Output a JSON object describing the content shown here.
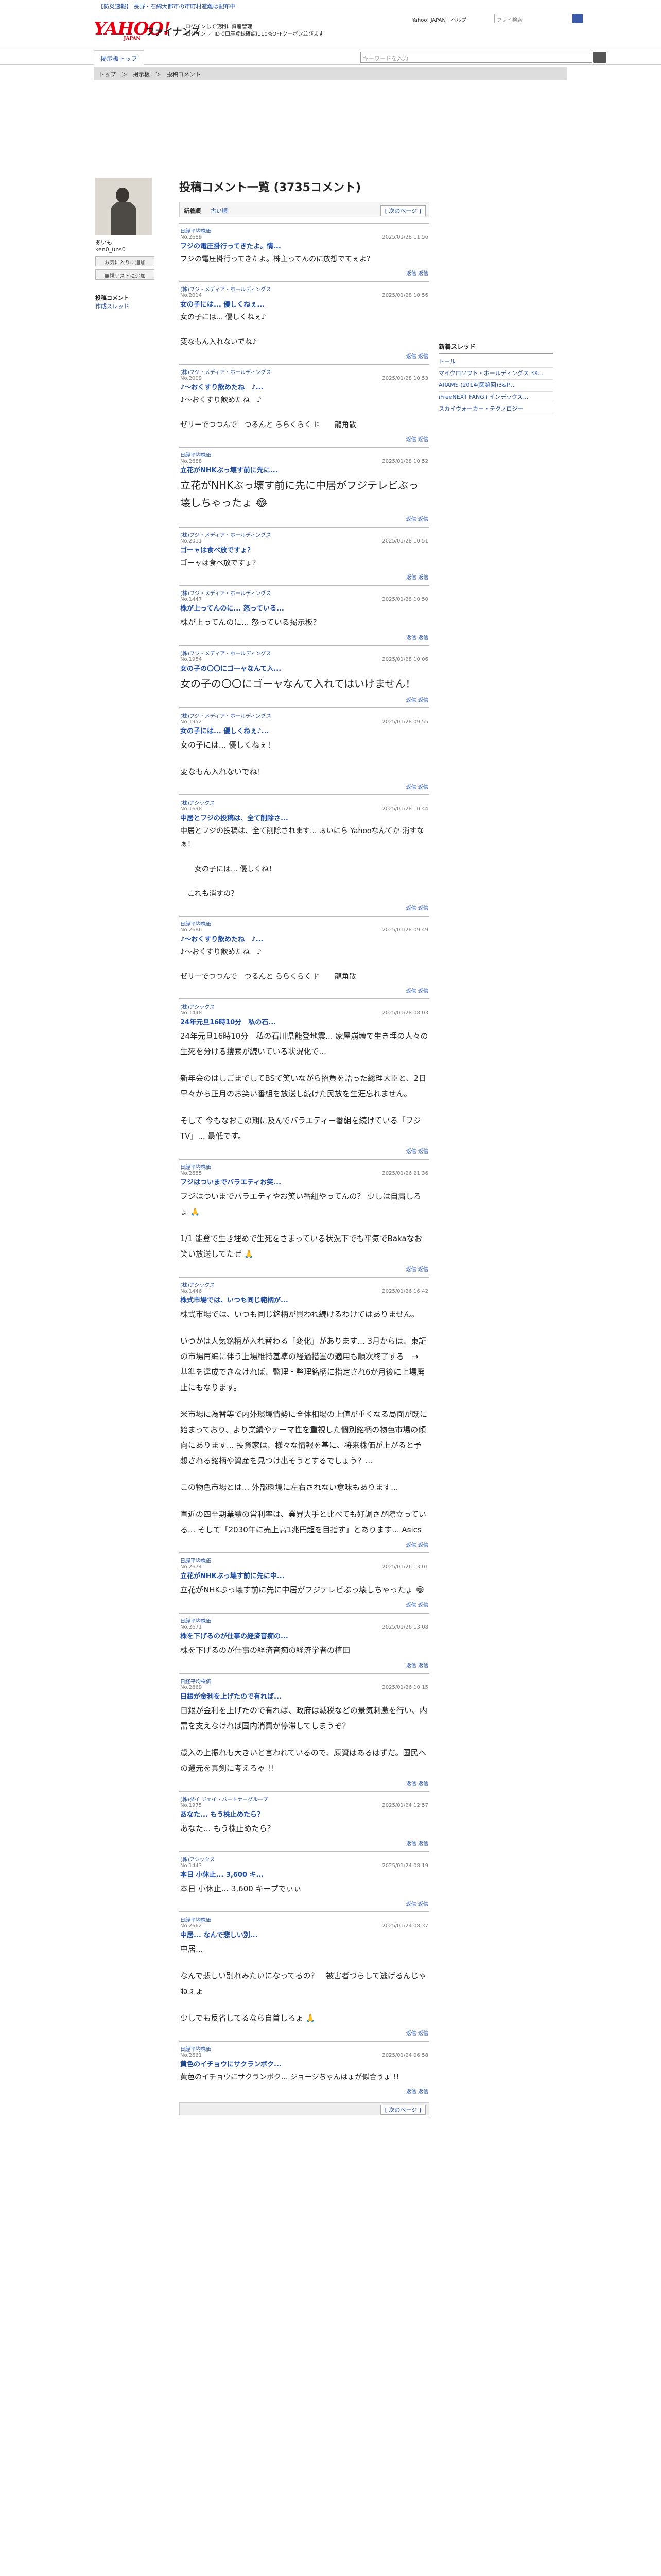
{
  "notice": {
    "prefix": "【防災速報】",
    "text": "長野・石綿大都市の市町村避難は配布中"
  },
  "header": {
    "logo": "YAHOO! JAPAN",
    "site": "ファイナンス",
    "promo_line1": "ログインして便利に資産管理",
    "promo_line2": "ログイン ／ IDで口座登録確認に10%OFFクーポン並びます",
    "links": "Yahoo! JAPAN　ヘルプ",
    "search_placeholder": "ファイ検索"
  },
  "nav": {
    "tab": "掲示板トップ",
    "quote_placeholder": "キーワードを入力"
  },
  "breadcrumb": "トップ　＞　掲示板　＞　投稿コメント",
  "profile": {
    "name": "あいも",
    "id": "ken0_uns0",
    "btn1": "お気に入りに追加",
    "btn2": "無視リストに追加",
    "nav1": "投稿コメント",
    "nav2": "作成スレッド"
  },
  "page": {
    "title": "投稿コメント一覧 (3735コメント)",
    "sort1": "新着順",
    "sort2": "古い順",
    "pager": "[ 次のページ ]"
  },
  "reply_label": "返信 返信",
  "sidebar": {
    "heading": "新着スレッド",
    "items": [
      "トール",
      "マイクロソフト・ホールディングス 3X...",
      "ARAMS (2014(図第回)3&P...",
      "iFreeNEXT FANG+インデックス...",
      "スカイウォーカー・テクノロジー"
    ]
  },
  "posts": [
    {
      "src": "日経平均株価",
      "no": "No.2689",
      "dt": "2025/01/28 11:56",
      "subj": "フジの電圧掛行ってきたよ。情...",
      "body": [
        "フジの電圧掛行ってきたよ。株主ってんのに放想でてぇよ？"
      ],
      "size": "s"
    },
    {
      "src": "(株)フジ・メディア・ホールディングス",
      "no": "No.2014",
      "dt": "2025/01/28 10:56",
      "subj": "女の子には... 優しくねぇ...",
      "body": [
        "女の子には... 優しくねぇ♪",
        "",
        "変なもん入れないでね♪"
      ],
      "size": "s"
    },
    {
      "src": "(株)フジ・メディア・ホールディングス",
      "no": "No.2009",
      "dt": "2025/01/28 10:53",
      "subj": "♪～おくすり飲めたね　♪...",
      "body": [
        "♪～おくすり飲めたね　♪",
        "",
        "ゼリーでつつんで　つるんと ららくらく ⚐　　龍角散"
      ],
      "size": "s"
    },
    {
      "src": "日経平均株価",
      "no": "No.2688",
      "dt": "2025/01/28 10:52",
      "subj": "立花がNHKぶっ壊す前に先に...",
      "body": [
        "立花がNHKぶっ壊す前に先に中居がフジテレビぶっ壊しちゃったょ 😂"
      ],
      "size": "l"
    },
    {
      "src": "(株)フジ・メディア・ホールディングス",
      "no": "No.2011",
      "dt": "2025/01/28 10:51",
      "subj": "ゴーャは食べ放ですょ？",
      "body": [
        "ゴーャは食べ放ですょ？"
      ],
      "size": "s"
    },
    {
      "src": "(株)フジ・メディア・ホールディングス",
      "no": "No.1447",
      "dt": "2025/01/28 10:50",
      "subj": "株が上ってんのに... 怒っている...",
      "body": [
        "株が上ってんのに... 怒っている掲示板？"
      ],
      "size": "m"
    },
    {
      "src": "(株)フジ・メディア・ホールディングス",
      "no": "No.1954",
      "dt": "2025/01/28 10:06",
      "subj": "女の子の〇〇にゴーャなんて入...",
      "body": [
        "女の子の〇〇にゴーャなんて入れてはいけません！"
      ],
      "size": "l"
    },
    {
      "src": "(株)フジ・メディア・ホールディングス",
      "no": "No.1952",
      "dt": "2025/01/28 09:55",
      "subj": "女の子には... 優しくねぇ♪...",
      "body": [
        "女の子には... 優しくねぇ！",
        "",
        "変なもん入れないでね！"
      ],
      "size": "m"
    },
    {
      "src": "(株)アシックス",
      "no": "No.1698",
      "dt": "2025/01/28 10:44",
      "subj": "中居とフジの投稿は、全て削除さ...",
      "body": [
        "中居とフジの投稿は、全て削除されます... ぁいにら Yahooなんてか 消すなぁ！",
        "",
        "　　女の子には... 優しくね！",
        "",
        "　これも消すの？"
      ],
      "size": "s"
    },
    {
      "src": "日経平均株価",
      "no": "No.2686",
      "dt": "2025/01/28 09:49",
      "subj": "♪～おくすり飲めたね　♪...",
      "body": [
        "♪～おくすり飲めたね　♪",
        "",
        "ゼリーでつつんで　つるんと ららくらく ⚐　　龍角散"
      ],
      "size": "s"
    },
    {
      "src": "(株)アシックス",
      "no": "No.1448",
      "dt": "2025/01/28 08:03",
      "subj": "24年元旦16時10分　私の石...",
      "body": [
        "24年元旦16時10分　私の石川県能登地震... 家屋崩壊で生き埋の人々の生死を分ける搜索が続いている状況化で...",
        "",
        "新年会のはしごまでしてBSで笑いながら招負を語った総理大臣と、2日早々から正月のお笑い番組を放送し続けた民放を生涯忘れません。",
        "",
        "そして 今もなおこの期に及んでバラエティー番組を続けている「フジTV」... 最低です。"
      ],
      "size": "m"
    },
    {
      "src": "日経平均株価",
      "no": "No.2685",
      "dt": "2025/01/26 21:36",
      "subj": "フジはついまでバラエティお笑...",
      "body": [
        "フジはついまでバラエティやお笑い番組やってんの？ 少しは自粛しろょ 🙏",
        "",
        "1/1 能登で生き埋めで生死をさまっている状況下でも平気でBakaなお笑い放送してたぜ 🙏"
      ],
      "size": "m"
    },
    {
      "src": "(株)アシックス",
      "no": "No.1446",
      "dt": "2025/01/26 16:42",
      "subj": "株式市場では、いつも同じ範柄が...",
      "body": [
        "株式市場では、いつも同じ銘柄が買われ続けるわけではありません。",
        "",
        "いつかは人気銘柄が入れ替わる「変化」があります... 3月からは、東証の市場再編に伴う上場維持基準の経過措置の適用も順次終了する　→　基準を達成できなければ、監理・整理銘柄に指定され6か月後に上場廃止にもなります。",
        "",
        "米市場に為替等で内外環境情勢に全体相場の上値が重くなる局面が既に始まっており、より業績やテーマ性を重視した個別銘柄の物色市場の傾向にあります... 投資家は、様々な情報を基に、将来株価が上がると予想される銘柄や資産を見つけ出そうとするでしょう？...",
        "",
        "この物色市場とは... 外部環境に左右されない意味もあります...",
        "",
        "直近の四半期業績の営利率は、業界大手と比べても好調さが際立っている... そして「2030年に売上高1兆円超を目指す」とあります... Asics"
      ],
      "size": "m"
    },
    {
      "src": "日経平均株価",
      "no": "No.2674",
      "dt": "2025/01/26 13:01",
      "subj": "立花がNHKぶっ壊す前に先に中...",
      "body": [
        "立花がNHKぶっ壊す前に先に中居がフジテレビぶっ壊しちゃったょ 😂"
      ],
      "size": "m"
    },
    {
      "src": "日経平均株価",
      "no": "No.2671",
      "dt": "2025/01/26 13:08",
      "subj": "株を下げるのが仕事の経済音痴の...",
      "body": [
        "株を下げるのが仕事の経済音痴の経済学者の植田"
      ],
      "size": "m"
    },
    {
      "src": "日経平均株価",
      "no": "No.2669",
      "dt": "2025/01/26 10:15",
      "subj": "日銀が金利を上げたので有れば...",
      "body": [
        "日銀が金利を上げたので有れば、政府は減税などの景気刺激を行い、内需を支えなければ国内消費が停滞してしまうぞ？",
        "",
        "歳入の上振れも大きいと言われているので、原資はあるはずだ。国民への還元を真剣に考えろゃ !!"
      ],
      "size": "m"
    },
    {
      "src": "(株)ダイ ジェイ・パートナーグループ",
      "no": "No.1975",
      "dt": "2025/01/24 12:57",
      "subj": "あなた... もう株止めたら？",
      "body": [
        "あなた... もう株止めたら？"
      ],
      "size": "m"
    },
    {
      "src": "(株)アシックス",
      "no": "No.1443",
      "dt": "2025/01/24 08:19",
      "subj": "本日 小休止... 3,600 キ...",
      "body": [
        "本日 小休止... 3,600 キープでぃぃ"
      ],
      "size": "m"
    },
    {
      "src": "日経平均株価",
      "no": "No.2662",
      "dt": "2025/01/24 08:37",
      "subj": "中居... なんで悲しい別...",
      "body": [
        "中居...",
        "",
        "なんで悲しい別れみたいになってるの？　被害者づらして逃げるんじゃねぇょ",
        "",
        "少しでも反省してるなら自首しろょ 🙏"
      ],
      "size": "m"
    },
    {
      "src": "日経平均株価",
      "no": "No.2661",
      "dt": "2025/01/24 06:58",
      "subj": "黄色のイチョウにサクランボク...",
      "body": [
        "黄色のイチョウにサクランボク... ジョージちゃんはょが似合うょ !!"
      ],
      "size": "s"
    }
  ]
}
